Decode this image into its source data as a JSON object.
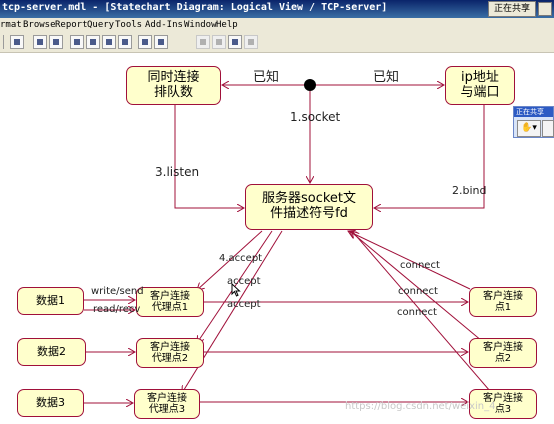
{
  "window": {
    "title": "tcp-server.mdl - [Statechart Diagram: Logical View / TCP-server]",
    "share_button": "正在共享"
  },
  "menu": [
    "rmat",
    "Browse",
    "Report",
    "Query",
    "Tools",
    "Add-Ins",
    "Window",
    "Help"
  ],
  "toolbar_icons": [
    "divider",
    "print-icon",
    "pointer-help-icon",
    "browser-window-icon",
    "doc-icon",
    "doc2-icon",
    "doc3-icon",
    "doc4-icon",
    "up-icon",
    "back-arrow-icon",
    "zoom-in-icon",
    "zoom-out-icon",
    "fit-icon",
    "layout-icon"
  ],
  "diagram": {
    "states": {
      "queue": "同时连接\n排队数",
      "ipport": "ip地址\n与端口",
      "fd": "服务器socket文\n件描述符号fd",
      "data1": "数据1",
      "data2": "数据2",
      "data3": "数据3",
      "proxy1": "客户连接\n代理点1",
      "proxy2": "客户连接\n代理点2",
      "proxy3": "客户连接\n代理点3",
      "client1": "客户连接\n点1",
      "client2": "客户连接\n点2",
      "client3": "客户连接\n点3"
    },
    "labels": {
      "known_left": "已知",
      "known_right": "已知",
      "socket": "1.socket",
      "listen": "3.listen",
      "bind": "2.bind",
      "accept4": "4.accept",
      "accept_a": "accept",
      "accept_b": "accept",
      "write_send": "write/send",
      "read_recv": "read/recv",
      "connect1": "connect",
      "connect2": "connect",
      "connect3": "connect"
    },
    "colors": {
      "state_fill": "#ffffcc",
      "state_border": "#a0103a",
      "transition": "#a0103a"
    }
  },
  "share_panel": {
    "title": "正在共享",
    "hand_button": "✋▾"
  },
  "watermark": "https://blog.csdn.net/weixin_4"
}
